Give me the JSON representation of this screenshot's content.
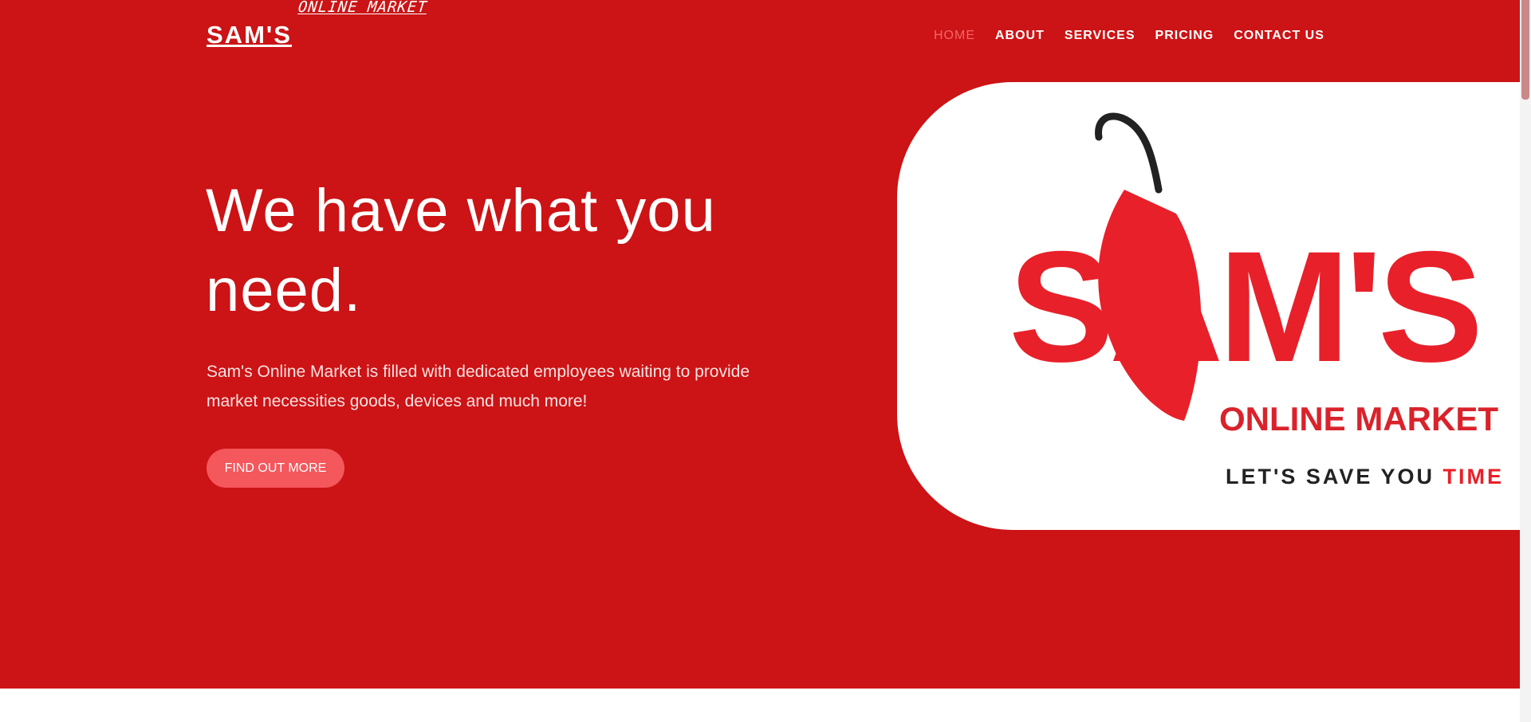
{
  "header": {
    "brand": "SAM'S",
    "brand_sub": "ONLINE MARKET",
    "nav": [
      {
        "label": "HOME",
        "active": true
      },
      {
        "label": "ABOUT",
        "active": false
      },
      {
        "label": "SERVICES",
        "active": false
      },
      {
        "label": "PRICING",
        "active": false
      },
      {
        "label": "CONTACT US",
        "active": false
      }
    ]
  },
  "hero": {
    "headline": "We have what you need.",
    "lead": "Sam's Online Market is filled with dedicated employees waiting to provide market necessities goods, devices and much more!",
    "cta_label": "FIND OUT MORE"
  },
  "logo": {
    "letters": "SAM'S",
    "subtitle": "ONLINE MARKET",
    "tagline_dark": "LET'S SAVE YOU ",
    "tagline_red": "TIME"
  },
  "colors": {
    "hero_bg": "#cc1315",
    "accent": "#f4575c",
    "logo_red": "#e8202a"
  },
  "icons": [
    "shopping-bag-icon"
  ]
}
